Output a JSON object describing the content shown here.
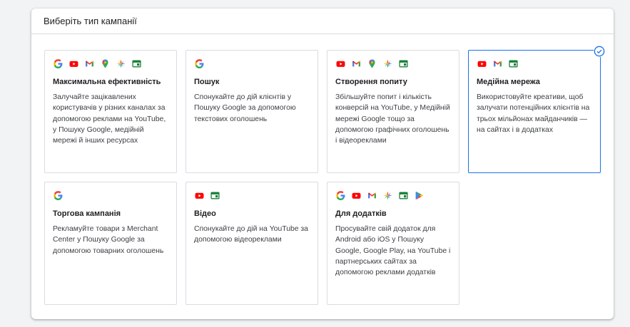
{
  "panel": {
    "title": "Виберіть тип кампанії"
  },
  "colors": {
    "selected_border": "#1a73e8",
    "google_blue": "#4285f4",
    "google_red": "#ea4335",
    "google_yellow": "#fbbc04",
    "google_green": "#34a853",
    "youtube_red": "#ff0000",
    "display_green": "#188038"
  },
  "cards": [
    {
      "title": "Максимальна ефективність",
      "description": "Залучайте зацікавлених користувачів у різних каналах за допомогою реклами на YouTube, у Пошуку Google, медійній мережі й інших ресурсах",
      "icons": [
        "google-icon",
        "youtube-icon",
        "gmail-icon",
        "maps-icon",
        "discover-icon",
        "display-icon"
      ],
      "selected": false
    },
    {
      "title": "Пошук",
      "description": "Спонукайте до дій клієнтів у Пошуку Google за допомогою текстових оголошень",
      "icons": [
        "google-icon"
      ],
      "selected": false
    },
    {
      "title": "Створення попиту",
      "description": "Збільшуйте попит і кількість конверсій на YouTube, у Медійній мережі Google тощо за допомогою графічних оголошень і відеореклами",
      "icons": [
        "youtube-icon",
        "gmail-icon",
        "maps-icon",
        "discover-icon",
        "display-icon"
      ],
      "selected": false
    },
    {
      "title": "Медійна мережа",
      "description": "Використовуйте креативи, щоб залучати потенційних клієнтів на трьох мільйонах майданчиків — на сайтах і в додатках",
      "icons": [
        "youtube-icon",
        "gmail-icon",
        "display-icon"
      ],
      "selected": true
    },
    {
      "title": "Торгова кампанія",
      "description": "Рекламуйте товари з Merchant Center у Пошуку Google за допомогою товарних оголошень",
      "icons": [
        "google-icon"
      ],
      "selected": false
    },
    {
      "title": "Відео",
      "description": "Спонукайте до дій на YouTube за допомогою відеореклами",
      "icons": [
        "youtube-icon",
        "display-icon"
      ],
      "selected": false
    },
    {
      "title": "Для додатків",
      "description": "Просувайте свій додаток для Android або iOS у Пошуку Google, Google Play, на YouTube і партнерських сайтах за допомогою реклами додатків",
      "icons": [
        "google-icon",
        "youtube-icon",
        "gmail-icon",
        "discover-icon",
        "display-icon",
        "play-icon"
      ],
      "selected": false
    }
  ]
}
